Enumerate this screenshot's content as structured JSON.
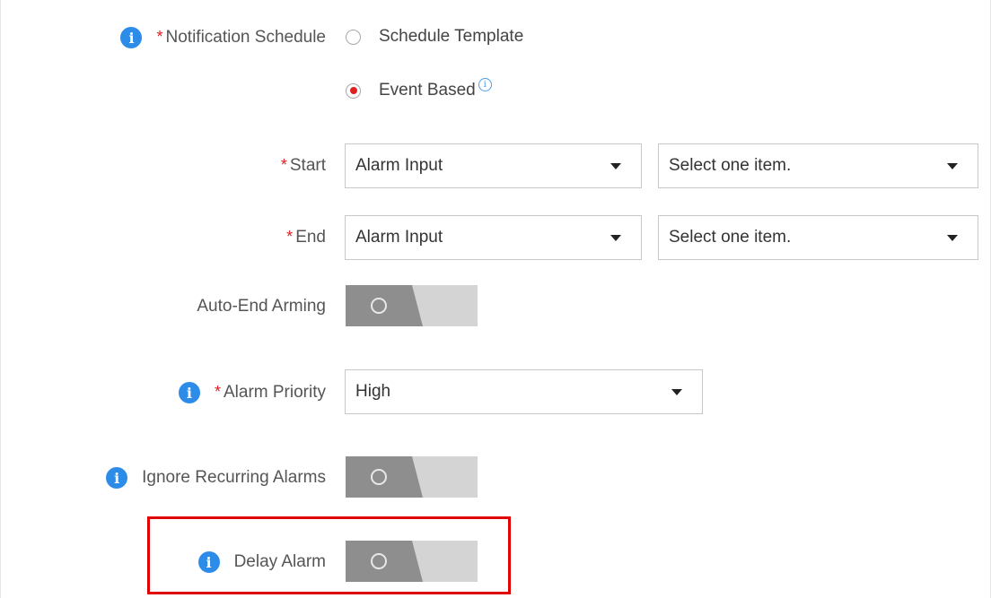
{
  "notification_schedule": {
    "label": "Notification Schedule",
    "required_mark": "*",
    "options": [
      {
        "label": "Schedule Template",
        "selected": false
      },
      {
        "label": "Event Based",
        "selected": true
      }
    ]
  },
  "start": {
    "required_mark": "*",
    "label": "Start",
    "type_value": "Alarm Input",
    "item_placeholder": "Select one item."
  },
  "end": {
    "required_mark": "*",
    "label": "End",
    "type_value": "Alarm Input",
    "item_placeholder": "Select one item."
  },
  "auto_end_arming": {
    "label": "Auto-End Arming",
    "enabled": false
  },
  "alarm_priority": {
    "required_mark": "*",
    "label": "Alarm Priority",
    "value": "High"
  },
  "ignore_recurring_alarms": {
    "label": "Ignore Recurring Alarms",
    "enabled": false
  },
  "delay_alarm": {
    "label": "Delay Alarm",
    "enabled": false
  },
  "colors": {
    "required": "#e02020",
    "info": "#2d8ce8",
    "highlight": "#e00000",
    "toggle_off_knob": "#8e8e8e",
    "toggle_track": "#d4d4d4"
  },
  "icons": {
    "info": "info-icon",
    "dropdown": "chevron-down-icon",
    "toggle": "toggle-switch"
  }
}
